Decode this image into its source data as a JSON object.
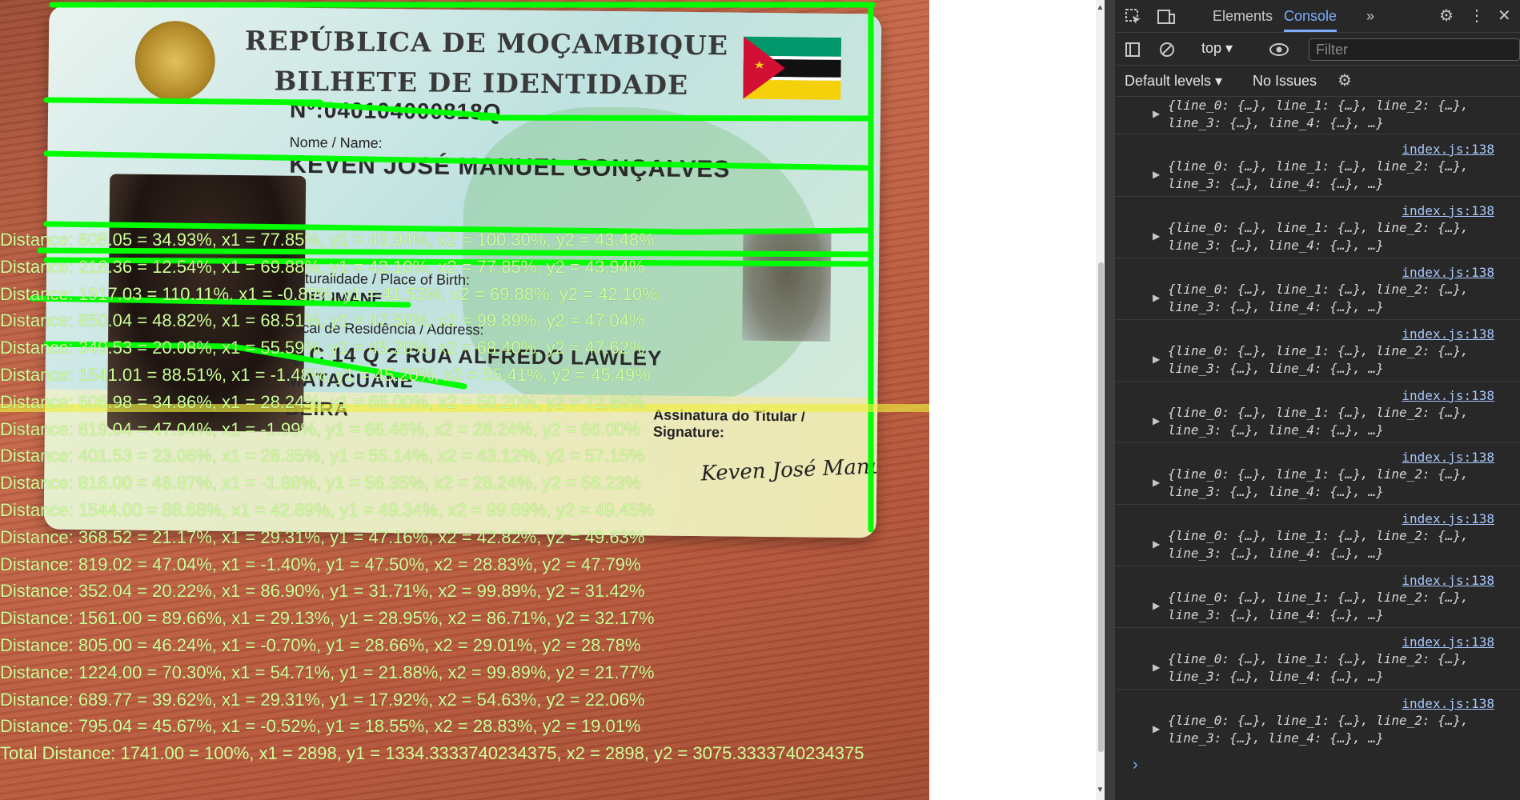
{
  "card": {
    "title1": "REPÚBLICA DE MOÇAMBIQUE",
    "title2": "BILHETE DE IDENTIDADE",
    "number": "Nº:040104000818Q",
    "name_label": "Nome / Name:",
    "name_value": "KEVEN JOSÉ MANUEL GONÇALVES",
    "birth_label": "Naturalidade / Place of Birth:",
    "birth_value": "QUELIMANE",
    "residence_label": "Local de Residência / Address:",
    "residence_value": "Q.C 14 Q 2 RUA ALFREDO LAWLEY",
    "city_line": "MATACUANE",
    "city": "BEIRA",
    "signature_label": "Assinatura do Titular / Signature:",
    "signature": "Keven José Manuel Gonçalves"
  },
  "overlay": {
    "distances": [
      "Distance: 608.05 = 34.93%, x1 = 77.85%, y1 = 43.94%, x2 = 100.30%, y2 = 43.48%",
      "Distance: 218.36 = 12.54%, x1 = 69.88%, y1 = 42.10%, x2 = 77.85%, y2 = 43.94%",
      "Distance: 1917.03 = 110.11%, x1 = -0.89%, y1 = 41.53%, x2 = 69.88%, y2 = 42.10%",
      "Distance: 850.04 = 48.82%, x1 = 68.51%, y1 = 47.50%, x2 = 99.89%, y2 = 47.04%",
      "Distance: 349.53 = 20.08%, x1 = 55.59%, y1 = 45.20%, x2 = 68.40%, y2 = 47.62%",
      "Distance: 1541.01 = 88.51%, x1 = -1.48%, y1 = 45.20%, x2 = 55.41%, y2 = 45.49%",
      "Distance: 606.98 = 34.86%, x1 = 28.24%, y1 = 66.00%, x2 = 50.20%, y2 = 72.89%",
      "Distance: 819.04 = 47.04%, x1 = -1.99%, y1 = 66.46%, x2 = 28.24%, y2 = 66.00%",
      "Distance: 401.53 = 23.06%, x1 = 28.35%, y1 = 55.14%, x2 = 43.12%, y2 = 57.15%",
      "Distance: 816.00 = 46.87%, x1 = -1.88%, y1 = 56.35%, x2 = 28.24%, y2 = 56.23%",
      "Distance: 1544.00 = 88.68%, x1 = 42.89%, y1 = 49.34%, x2 = 99.89%, y2 = 49.45%",
      "Distance: 368.52 = 21.17%, x1 = 29.31%, y1 = 47.16%, x2 = 42.82%, y2 = 49.63%",
      "Distance: 819.02 = 47.04%, x1 = -1.40%, y1 = 47.50%, x2 = 28.83%, y2 = 47.79%",
      "Distance: 352.04 = 20.22%, x1 = 86.90%, y1 = 31.71%, x2 = 99.89%, y2 = 31.42%",
      "Distance: 1561.00 = 89.66%, x1 = 29.13%, y1 = 28.95%, x2 = 86.71%, y2 = 32.17%",
      "Distance: 805.00 = 46.24%, x1 = -0.70%, y1 = 28.66%, x2 = 29.01%, y2 = 28.78%",
      "Distance: 1224.00 = 70.30%, x1 = 54.71%, y1 = 21.88%, x2 = 99.89%, y2 = 21.77%",
      "Distance: 689.77 = 39.62%, x1 = 29.31%, y1 = 17.92%, x2 = 54.63%, y2 = 22.06%",
      "Distance: 795.04 = 45.67%, x1 = -0.52%, y1 = 18.55%, x2 = 28.83%, y2 = 19.01%"
    ],
    "total": "Total Distance: 1741.00 = 100%, x1 = 2898, y1 = 1334.3333740234375, x2 = 2898, y2 = 3075.3333740234375",
    "line_color": "#00ff00",
    "text_color": "#ccff99"
  },
  "devtools": {
    "tabs": {
      "elements": "Elements",
      "console": "Console"
    },
    "context": "top",
    "filter_placeholder": "Filter",
    "levels": "Default levels ▾",
    "issues": "No Issues",
    "source": "index.js:138",
    "log_line1": "{line_0: {…}, line_1: {…}, line_2: {…},",
    "log_line2": "line_3: {…}, line_4: {…}, …}",
    "icons": [
      "inspect-icon",
      "device-toggle-icon",
      "more-tabs-icon",
      "settings-icon",
      "kebab-menu-icon",
      "close-icon",
      "sidebar-icon",
      "clear-icon",
      "eye-icon",
      "console-settings-icon"
    ]
  }
}
